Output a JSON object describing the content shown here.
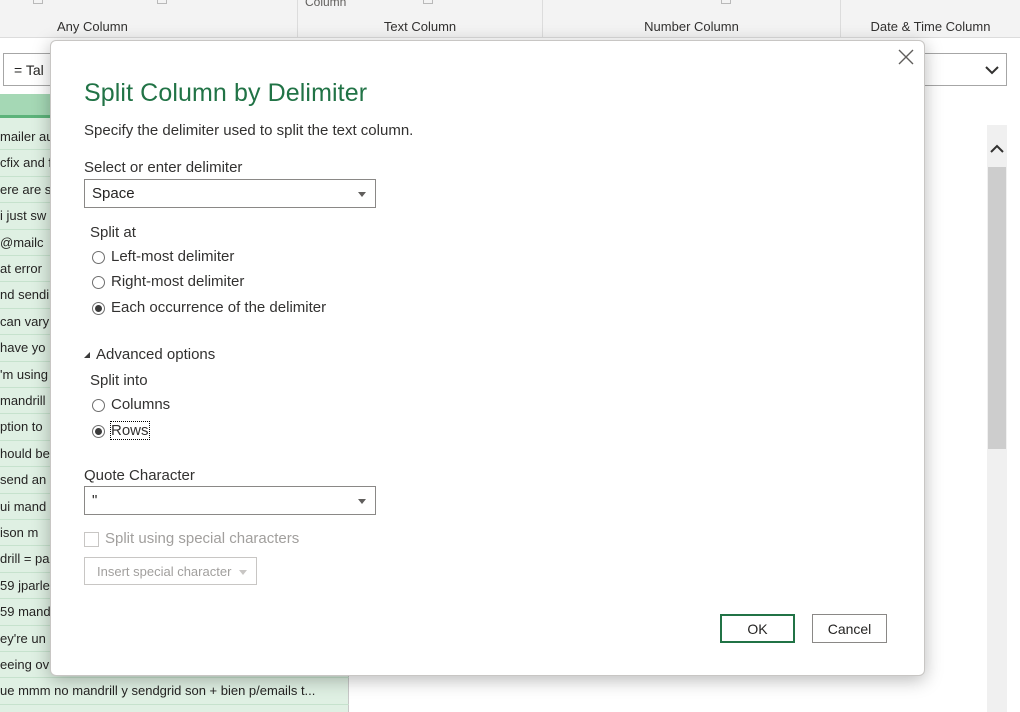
{
  "ribbon": {
    "groups": [
      {
        "label": "Any Column"
      },
      {
        "label": "Text Column"
      },
      {
        "label": "Number Column"
      },
      {
        "label": "Date & Time Column"
      }
    ],
    "column_label": "Column"
  },
  "formula_bar": {
    "text": "= Tal"
  },
  "grid": {
    "rows": [
      "mailer au",
      "cfix and f",
      "ere are s",
      "i just sw",
      " @mailc",
      "at error",
      "nd sendi",
      "can vary",
      "have yo",
      "'m using",
      "mandrill",
      "ption to",
      "hould be",
      " send an",
      "ui  mand",
      "ison   m",
      "drill = pa",
      "59 jparle",
      "59 mand",
      "ey're un",
      "eeing ov",
      "ue mmm no  mandrill y sendgrid son + bien p/emails t..."
    ]
  },
  "dialog": {
    "title": "Split Column by Delimiter",
    "description": "Specify the delimiter used to split the text column.",
    "delimiter_label": "Select or enter delimiter",
    "delimiter_value": "Space",
    "split_at_label": "Split at",
    "split_at_options": [
      {
        "label": "Left-most delimiter",
        "checked": false
      },
      {
        "label": "Right-most delimiter",
        "checked": false
      },
      {
        "label": "Each occurrence of the delimiter",
        "checked": true
      }
    ],
    "advanced_label": "Advanced options",
    "split_into_label": "Split into",
    "split_into_options": [
      {
        "label": "Columns",
        "checked": false
      },
      {
        "label": "Rows",
        "checked": true
      }
    ],
    "quote_label": "Quote Character",
    "quote_value": "\"",
    "special_chars_label": "Split using special characters",
    "insert_special_label": "Insert special character",
    "ok_label": "OK",
    "cancel_label": "Cancel"
  },
  "colors": {
    "accent": "#217346",
    "grid_bg": "#dff0e3",
    "grid_header": "#a5d8b5",
    "disabled_text": "#a19f9d"
  },
  "icons": [
    "close-icon",
    "chevron-down-icon",
    "chevron-up-icon",
    "dropdown-caret-icon",
    "collapse-triangle-icon"
  ]
}
